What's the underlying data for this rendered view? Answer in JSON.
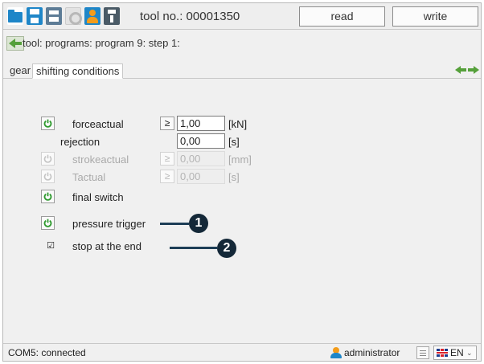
{
  "toolbar": {
    "tool_no": "tool no.: 00001350",
    "read_label": "read",
    "write_label": "write",
    "icons": [
      "folder-icon",
      "save-icon",
      "print-icon",
      "settings-icon",
      "user-icon",
      "tool-icon"
    ]
  },
  "breadcrumb": {
    "text": "tool: programs: program 9: step 1:"
  },
  "tabs": [
    {
      "label": "gear"
    },
    {
      "label": "shifting conditions"
    }
  ],
  "conditions": {
    "force": {
      "label": "forceactual",
      "operator": "≥",
      "value": "1,00",
      "unit": "[kN]",
      "enabled": true
    },
    "rejection": {
      "label": "rejection",
      "value": "0,00",
      "unit": "[s]"
    },
    "stroke": {
      "label": "strokeactual",
      "operator": "≥",
      "value": "0,00",
      "unit": "[mm]",
      "enabled": false
    },
    "time": {
      "label": "Tactual",
      "operator": "≥",
      "value": "0,00",
      "unit": "[s]",
      "enabled": false
    },
    "final_switch": {
      "label": "final switch",
      "enabled": true
    },
    "pressure_trigger": {
      "label": "pressure trigger",
      "enabled": true
    },
    "stop_at_end": {
      "label": "stop at the end",
      "checked": true,
      "checkmark": "☑"
    }
  },
  "callouts": [
    {
      "number": "1"
    },
    {
      "number": "2"
    }
  ],
  "status": {
    "connection": "COM5: connected",
    "user": "administrator",
    "language": "EN",
    "caret": "⌄"
  },
  "colors": {
    "accent_blue": "#1e86c8",
    "power_green": "#2e9a2e",
    "nav_green": "#55a03a",
    "callout": "#142838"
  }
}
